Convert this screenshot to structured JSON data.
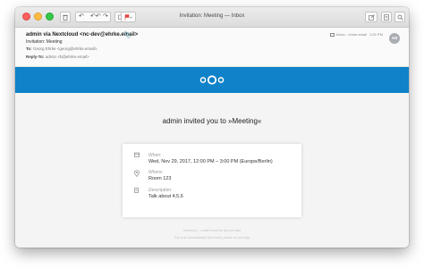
{
  "window": {
    "title": "Invitation: Meeting — Inbox"
  },
  "toolbar": {
    "delete_icon": "trash-icon",
    "reply_icon": "reply-icon",
    "reply_all_icon": "reply-all-icon",
    "forward_icon": "forward-icon",
    "move_icon": "folder-icon",
    "flag_icon": "flag-icon",
    "compose_icon": "compose-icon",
    "note_icon": "note-icon",
    "search_icon": "search-icon"
  },
  "header": {
    "from": "admin via Nextcloud <nc-dev@ehrke.email>",
    "subject": "Invitation: Meeting",
    "to_label": "To:",
    "to_value": "Georg Ehrke <georg@ehrke.email>,",
    "reply_label": "Reply-To:",
    "reply_value": "admin <b@ehrke.email>",
    "mailbox": "Inbox - ehrke.email",
    "time": "1:52 PM",
    "avatar": "AN"
  },
  "body": {
    "title": "admin invited you to »Meeting«",
    "when_label": "When:",
    "when_value": "Wed, Nov 29, 2017, 12:00 PM – 3:00 PM (Europe/Berlin)",
    "where_label": "Where:",
    "where_value": "Room 123",
    "description_label": "Description:",
    "description_value": "Talk about 4,5,6",
    "footer_line1": "Nextcloud – a safe home for all your data",
    "footer_line2": "This is an automatically sent email, please do not reply."
  },
  "colors": {
    "banner": "#0f82c9",
    "body_bg": "#f4f4f4"
  }
}
